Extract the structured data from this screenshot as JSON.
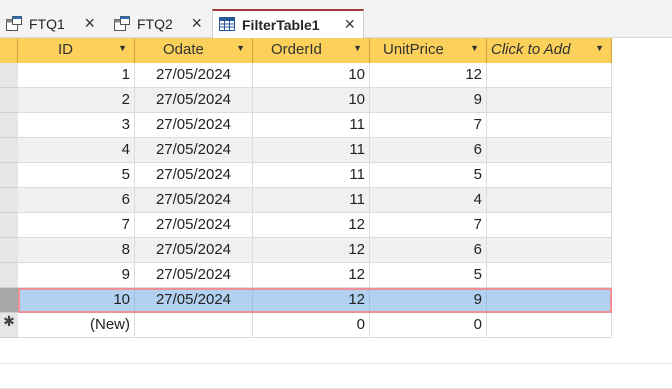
{
  "tabs": [
    {
      "label": "FTQ1",
      "icon": "query-icon",
      "close": "×",
      "active": false
    },
    {
      "label": "FTQ2",
      "icon": "query-icon",
      "close": "×",
      "active": false
    },
    {
      "label": "FilterTable1",
      "icon": "table-icon",
      "close": "×",
      "active": true
    }
  ],
  "columns": [
    {
      "label": "ID",
      "dropdown": "▼"
    },
    {
      "label": "Odate",
      "dropdown": "▼"
    },
    {
      "label": "OrderId",
      "dropdown": "▼"
    },
    {
      "label": "UnitPrice",
      "dropdown": "▼"
    },
    {
      "label": "Click to Add",
      "dropdown": "▼"
    }
  ],
  "rows": [
    {
      "id": "1",
      "odate": "27/05/2024",
      "orderid": "10",
      "unitprice": "12"
    },
    {
      "id": "2",
      "odate": "27/05/2024",
      "orderid": "10",
      "unitprice": "9"
    },
    {
      "id": "3",
      "odate": "27/05/2024",
      "orderid": "11",
      "unitprice": "7"
    },
    {
      "id": "4",
      "odate": "27/05/2024",
      "orderid": "11",
      "unitprice": "6"
    },
    {
      "id": "5",
      "odate": "27/05/2024",
      "orderid": "11",
      "unitprice": "5"
    },
    {
      "id": "6",
      "odate": "27/05/2024",
      "orderid": "11",
      "unitprice": "4"
    },
    {
      "id": "7",
      "odate": "27/05/2024",
      "orderid": "12",
      "unitprice": "7"
    },
    {
      "id": "8",
      "odate": "27/05/2024",
      "orderid": "12",
      "unitprice": "6"
    },
    {
      "id": "9",
      "odate": "27/05/2024",
      "orderid": "12",
      "unitprice": "5"
    },
    {
      "id": "10",
      "odate": "27/05/2024",
      "orderid": "12",
      "unitprice": "9"
    }
  ],
  "selected_row_index": 9,
  "new_row": {
    "marker": "✱",
    "id": "(New)",
    "odate": "",
    "orderid": "0",
    "unitprice": "0"
  },
  "colors": {
    "header": "#fbd15b",
    "selected_row": "#b2d1f0",
    "selected_border": "#f08f97",
    "active_tab_accent": "#a4373a"
  }
}
